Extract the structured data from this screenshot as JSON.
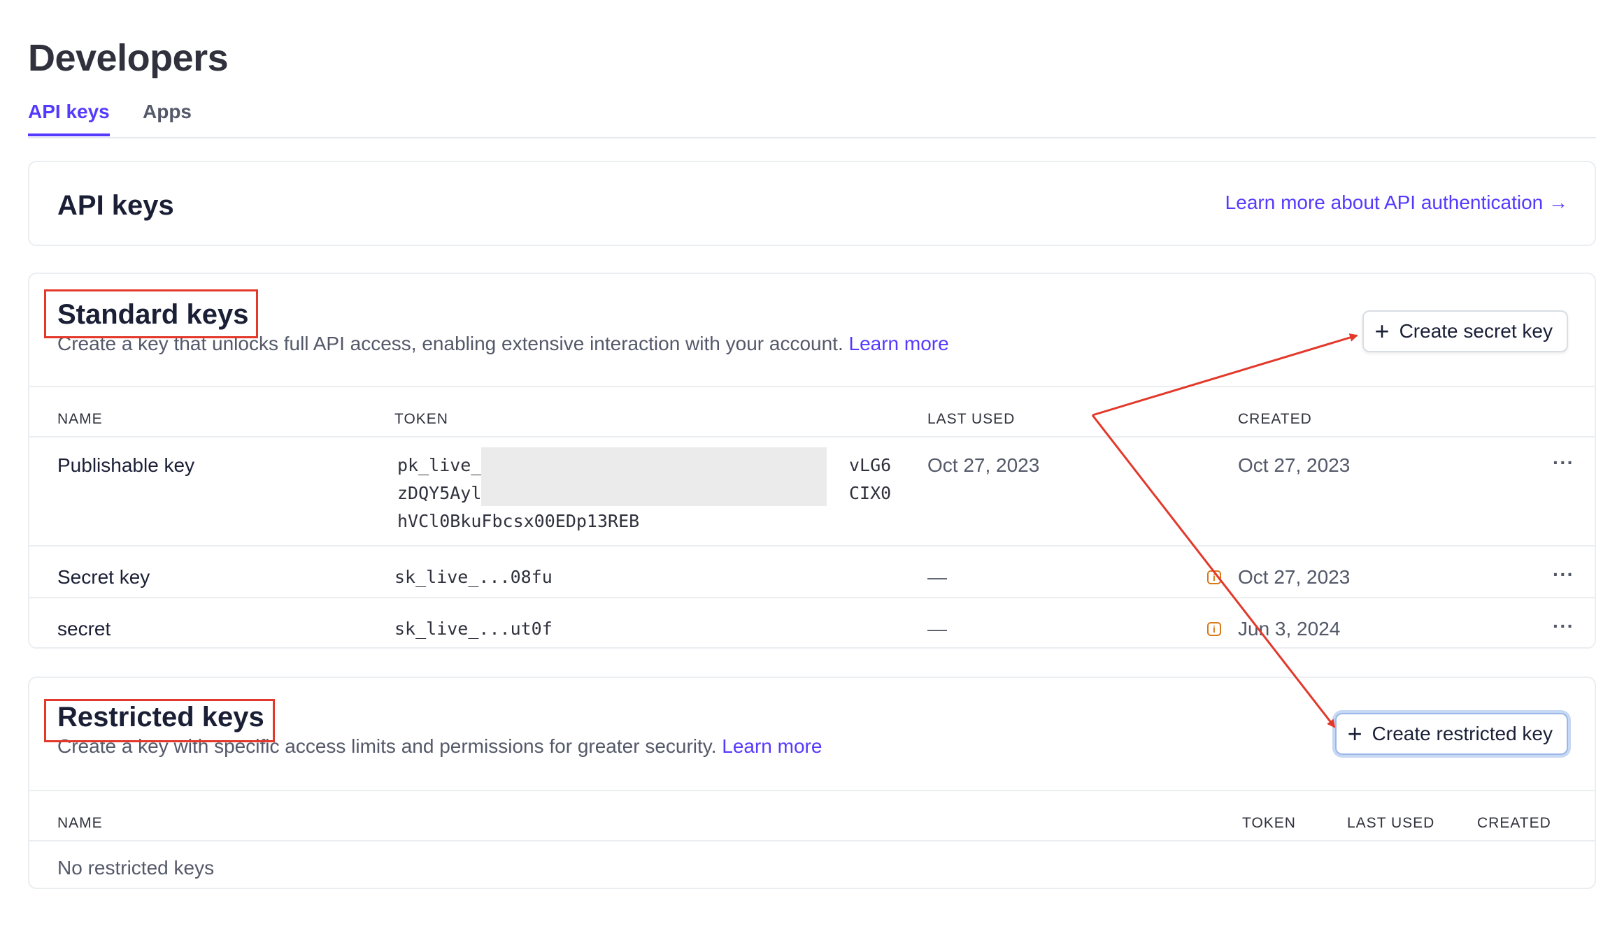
{
  "page": {
    "title": "Developers"
  },
  "tabs": [
    {
      "label": "API keys",
      "active": true
    },
    {
      "label": "Apps",
      "active": false
    }
  ],
  "header_card": {
    "title": "API keys",
    "link": "Learn more about API authentication →"
  },
  "standard_keys": {
    "title": "Standard keys",
    "description": "Create a key that unlocks full API access, enabling extensive interaction with your account.",
    "learn_more": "Learn more",
    "create_button": "Create secret key",
    "columns": [
      "NAME",
      "TOKEN",
      "LAST USED",
      "CREATED"
    ],
    "rows": [
      {
        "name": "Publishable key",
        "token_lines": [
          "pk_live_",
          "zDQY5Ayl",
          "hVCl0BkuFbcsx00EDp13REB"
        ],
        "token_tail_lines": [
          "vLG6",
          "CIX0"
        ],
        "last_used": "Oct 27, 2023",
        "created": "Oct 27, 2023",
        "menu": "···"
      },
      {
        "name": "Secret key",
        "token": "sk_live_...08fu",
        "last_used": "—",
        "created": "Oct 27, 2023",
        "menu": "···"
      },
      {
        "name": "secret",
        "token": "sk_live_...ut0f",
        "last_used": "—",
        "created": "Jun 3, 2024",
        "menu": "···"
      }
    ]
  },
  "restricted_keys": {
    "title": "Restricted keys",
    "description": "Create a key with specific access limits and permissions for greater security.",
    "learn_more": "Learn more",
    "create_button": "Create restricted key",
    "columns": [
      "NAME",
      "TOKEN",
      "LAST USED",
      "CREATED"
    ],
    "empty_text": "No restricted keys"
  },
  "icons": {
    "plus": "plus-icon",
    "info": "info-icon",
    "more": "more-icon",
    "arrow": "arrow-right-icon"
  },
  "colors": {
    "accent": "#533afd",
    "annotation": "#e2392b",
    "warning": "#d97917"
  }
}
